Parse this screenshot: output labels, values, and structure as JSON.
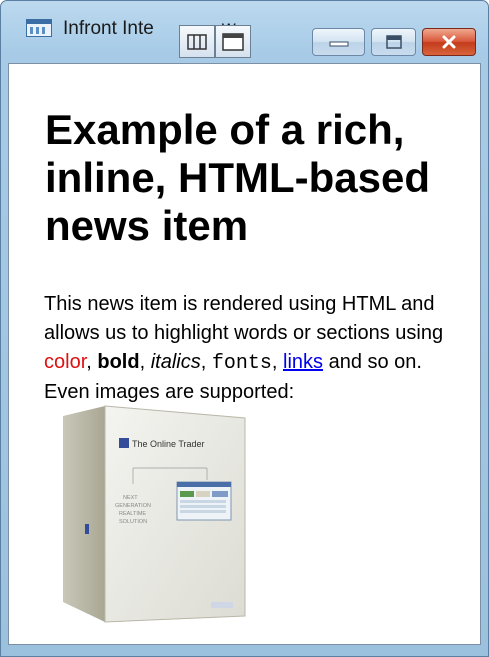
{
  "window": {
    "title": "Infront Inte",
    "title_tail": "w...",
    "icons": {
      "app": "app-window-icon",
      "overlay_1": "dock-icon",
      "overlay_2": "window-icon",
      "minimize": "minimize-icon",
      "maximize": "maximize-icon",
      "close": "close-icon"
    }
  },
  "article": {
    "headline": "Example of a rich, inline, HTML-based news item",
    "body": {
      "text1": "This news item is rendered using HTML and allows us to highlight words or sections using ",
      "color_word": "color",
      "sep1": ", ",
      "bold_word": "bold",
      "sep2": ", ",
      "italic_word": "italics",
      "sep3": ", ",
      "mono_word": "fonts",
      "sep4": ", ",
      "link_word": "links",
      "text2": " and so on. Even images are supported:"
    },
    "image": {
      "brand": "The Online Trader",
      "line1": "NEXT",
      "line2": "GENERATION",
      "line3": "REALTIME",
      "line4": "SOLUTION"
    }
  },
  "colors": {
    "accent_red": "#e01010",
    "link": "#0000ee",
    "titlebar": "#a7cbe7",
    "close_button": "#c33b1c"
  }
}
